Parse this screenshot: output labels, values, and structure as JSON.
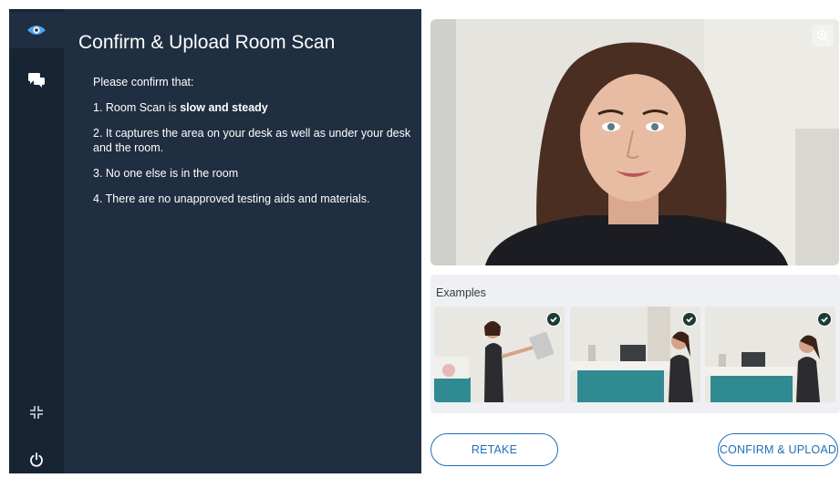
{
  "rail": {
    "icons": [
      "eye-icon",
      "chat-icon",
      "collapse-icon",
      "power-icon"
    ]
  },
  "panel": {
    "title": "Confirm & Upload Room Scan",
    "intro": "Please confirm that:",
    "item1_prefix": "1. Room Scan is ",
    "item1_bold": "slow and steady",
    "item2": "2. It captures the area on your desk as well as under your desk and the room.",
    "item3": "3. No one else is in the room",
    "item4": "4. There are no unapproved testing aids and materials."
  },
  "preview": {
    "zoom_icon": "zoom-in-icon"
  },
  "examples": {
    "label": "Examples",
    "check_icon": "check-icon"
  },
  "buttons": {
    "retake": "RETAKE",
    "confirm": "CONFIRM & UPLOAD"
  },
  "colors": {
    "rail": "#172433",
    "panel": "#1f2e40",
    "accent": "#1f6fb5",
    "eye_icon": "#4fa3e8"
  }
}
